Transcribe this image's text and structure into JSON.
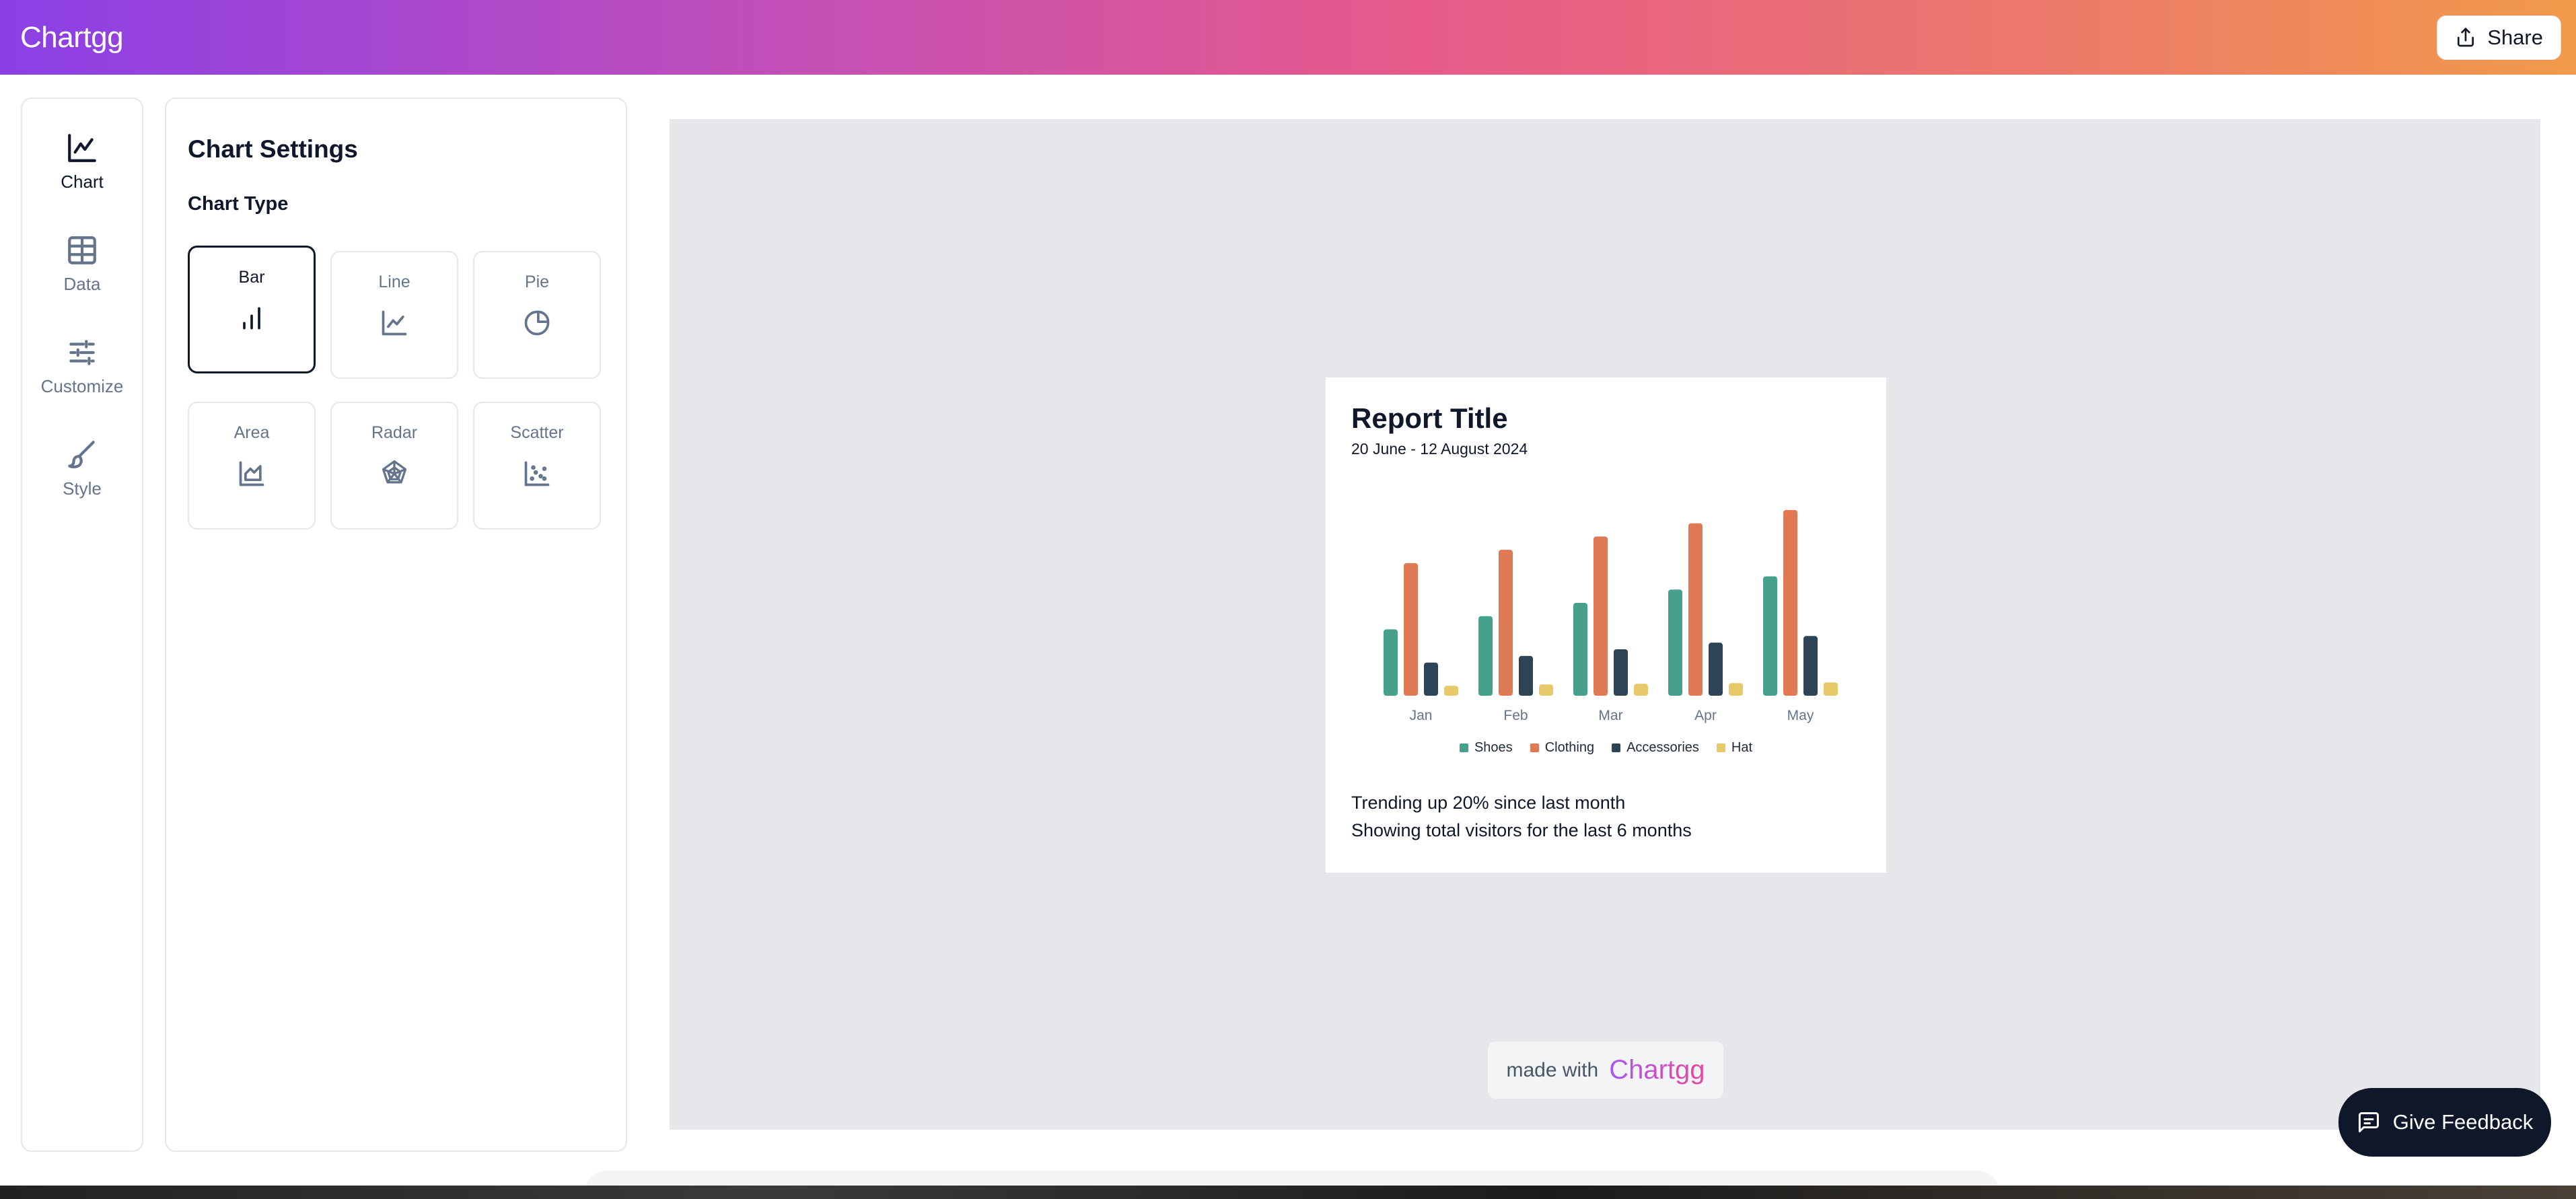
{
  "app": {
    "brand": "Chartgg",
    "share_label": "Share"
  },
  "rail": {
    "items": [
      {
        "label": "Chart",
        "icon": "chart-icon",
        "active": true
      },
      {
        "label": "Data",
        "icon": "table-icon",
        "active": false
      },
      {
        "label": "Customize",
        "icon": "sliders-icon",
        "active": false
      },
      {
        "label": "Style",
        "icon": "brush-icon",
        "active": false
      }
    ]
  },
  "settings": {
    "title": "Chart Settings",
    "chart_type_label": "Chart Type",
    "types": [
      {
        "label": "Bar",
        "icon": "bar-chart-icon",
        "selected": true
      },
      {
        "label": "Line",
        "icon": "line-chart-icon",
        "selected": false
      },
      {
        "label": "Pie",
        "icon": "pie-chart-icon",
        "selected": false
      },
      {
        "label": "Area",
        "icon": "area-chart-icon",
        "selected": false
      },
      {
        "label": "Radar",
        "icon": "radar-chart-icon",
        "selected": false
      },
      {
        "label": "Scatter",
        "icon": "scatter-chart-icon",
        "selected": false
      }
    ]
  },
  "report": {
    "title": "Report Title",
    "date_range": "20 June - 12 August 2024",
    "footer_line1": "Trending up 20% since last month",
    "footer_line2": "Showing total visitors for the last 6 months"
  },
  "chart_data": {
    "type": "bar",
    "categories": [
      "Jan",
      "Feb",
      "Mar",
      "Apr",
      "May"
    ],
    "series": [
      {
        "name": "Shoes",
        "color": "#47a08c",
        "values": [
          100,
          120,
          140,
          160,
          180
        ]
      },
      {
        "name": "Clothing",
        "color": "#e07a55",
        "values": [
          200,
          220,
          240,
          260,
          280
        ]
      },
      {
        "name": "Accessories",
        "color": "#2d4456",
        "values": [
          50,
          60,
          70,
          80,
          90
        ]
      },
      {
        "name": "Hat",
        "color": "#e8c96a",
        "values": [
          15,
          17,
          18,
          19,
          20
        ]
      }
    ],
    "ylim": [
      0,
      280
    ],
    "grid": false,
    "legend": "bottom"
  },
  "watermark": {
    "prefix": "made with",
    "brand": "Chartgg"
  },
  "feedback_label": "Give Feedback",
  "colors": {
    "accent_start": "#8b3fe6",
    "accent_end": "#f29a4a",
    "dark": "#0f172a"
  }
}
